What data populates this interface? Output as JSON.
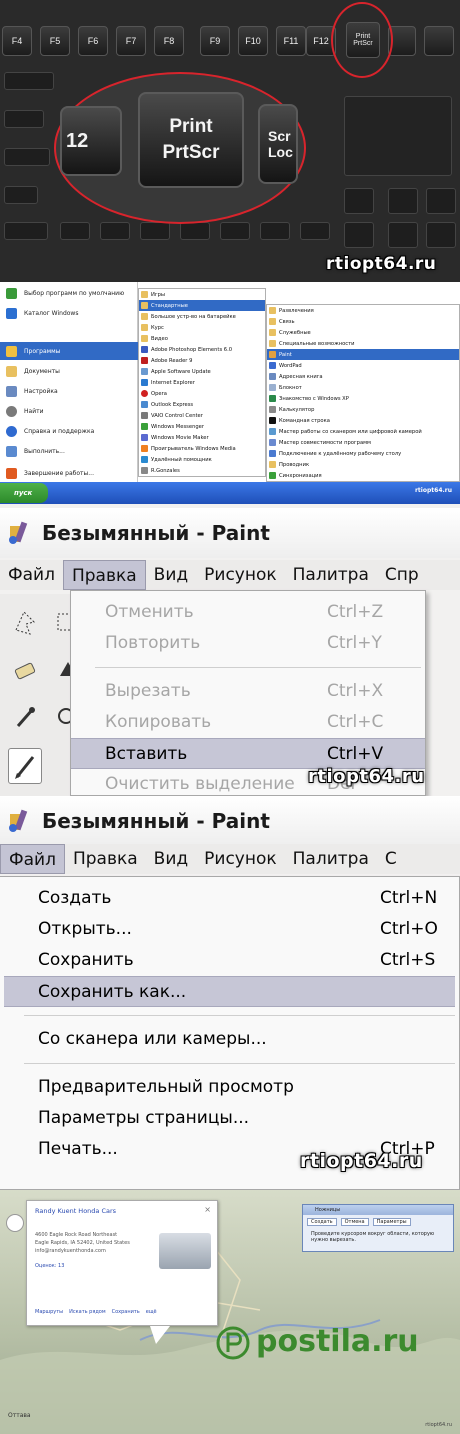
{
  "keyboard": {
    "fkeys": [
      "F4",
      "F5",
      "F6",
      "F7",
      "F8",
      "F9",
      "F10",
      "F11",
      "F12"
    ],
    "print_key_small": {
      "line1": "Print",
      "line2": "PrtScr"
    },
    "print_key_zoom": {
      "line1": "Print",
      "line2": "PrtScr"
    },
    "zoom_f12": "12",
    "zoom_scroll": {
      "line1": "Scr",
      "line2": "Loc"
    },
    "watermark": "rtiopt64.ru"
  },
  "start_menu": {
    "left_items": [
      "Выбор программ по умолчанию",
      "Каталог Windows",
      "Программы",
      "Документы",
      "Настройка",
      "Найти",
      "Справка и поддержка",
      "Выполнить...",
      "Завершение работы..."
    ],
    "col1": [
      "Игры",
      "Стандартные",
      "Большое устр-во на батарейке",
      "Курс",
      "Видео",
      "Adobe Photoshop Elements 6.0",
      "Adobe Reader 9",
      "Apple Software Update",
      "Internet Explorer",
      "Opera",
      "Outlook Express",
      "VAIO Control Center",
      "Windows Messenger",
      "Windows Movie Maker",
      "Проигрыватель Windows Media",
      "Удалённый помощник",
      "R.Gonzales"
    ],
    "col2": [
      "Развлечения",
      "Связь",
      "Служебные",
      "Специальные возможности",
      "Paint",
      "WordPad",
      "Адресная книга",
      "Блокнот",
      "Знакомство с Windows XP",
      "Калькулятор",
      "Командная строка",
      "Мастер работы со сканером или цифровой камерой",
      "Мастер совместимости программ",
      "Подключение к удалённому рабочему столу",
      "Проводник",
      "Синхронизация"
    ],
    "start_label": "пуск",
    "watermark": "rtiopt64.ru"
  },
  "paint_edit": {
    "title": "Безымянный - Paint",
    "menus": [
      "Файл",
      "Правка",
      "Вид",
      "Рисунок",
      "Палитра",
      "Спр"
    ],
    "items": [
      {
        "label": "Отменить",
        "shortcut": "Ctrl+Z"
      },
      {
        "label": "Повторить",
        "shortcut": "Ctrl+Y"
      },
      {
        "label": "Вырезать",
        "shortcut": "Ctrl+X"
      },
      {
        "label": "Копировать",
        "shortcut": "Ctrl+C"
      },
      {
        "label": "Вставить",
        "shortcut": "Ctrl+V"
      },
      {
        "label": "Очистить выделение",
        "shortcut": "Del"
      }
    ],
    "watermark": "rtiopt64.ru"
  },
  "paint_file": {
    "title": "Безымянный - Paint",
    "menus": [
      "Файл",
      "Правка",
      "Вид",
      "Рисунок",
      "Палитра",
      "С"
    ],
    "items": [
      {
        "label": "Создать",
        "shortcut": "Ctrl+N"
      },
      {
        "label": "Открыть...",
        "shortcut": "Ctrl+O"
      },
      {
        "label": "Сохранить",
        "shortcut": "Ctrl+S"
      },
      {
        "label": "Сохранить как...",
        "shortcut": ""
      },
      {
        "label": "Со сканера или камеры...",
        "shortcut": ""
      },
      {
        "label": "Предварительный просмотр",
        "shortcut": ""
      },
      {
        "label": "Параметры страницы...",
        "shortcut": ""
      },
      {
        "label": "Печать...",
        "shortcut": "Ctrl+P"
      }
    ],
    "watermark": "rtiopt64.ru"
  },
  "map": {
    "card_title": "Randy Kuent Honda Cars",
    "card_lines": [
      "4600 Eagle Rock Road Northeast",
      "Eagle Rapids, IA 52402, United States",
      "info@randykuenthonda.com"
    ],
    "card_link": "Оценок: 13",
    "card_footer": [
      "Маршруты",
      "Искать рядом",
      "Сохранить",
      "ещё"
    ],
    "dialog_title": "Ножницы",
    "dialog_buttons": [
      "Создать",
      "Отмена",
      "Параметры"
    ],
    "dialog_text": "Проведите курсором вокруг области, которую нужно вырезать.",
    "bottom_labels": [
      "Оттава"
    ],
    "big_watermark": "postila.ru",
    "tiny_stamp": "rtiopt64.ru"
  },
  "colors": {
    "highlight_ellipse": "#d8242c",
    "xp_selection": "#316ac5",
    "paint_hover": "#c6c6d6",
    "postila_green": "#3c8a2e"
  }
}
